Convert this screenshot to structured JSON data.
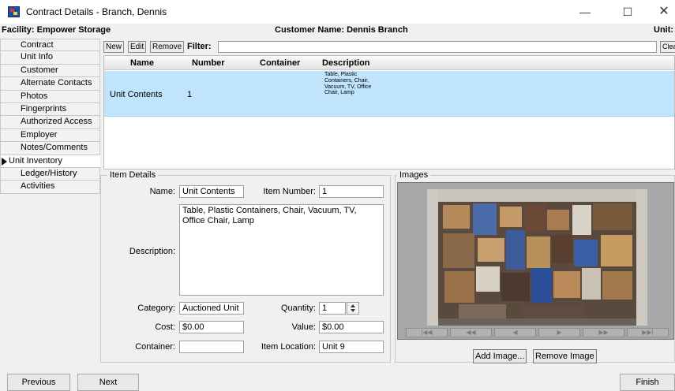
{
  "window": {
    "title": "Contract Details - Branch, Dennis",
    "minimize": "—",
    "maximize": "☐",
    "close": "✕"
  },
  "info": {
    "facility": "Facility: Empower Storage",
    "customer": "Customer Name: Dennis Branch",
    "unit": "Unit:"
  },
  "nav": {
    "items": [
      "Contract",
      "Unit Info",
      "Customer",
      "Alternate Contacts",
      "Photos",
      "Fingerprints",
      "Authorized Access",
      "Employer",
      "Notes/Comments",
      "Unit Inventory",
      "Ledger/History",
      "Activities"
    ],
    "active_index": 9
  },
  "toolbar": {
    "new": "New",
    "edit": "Edit",
    "remove": "Remove",
    "filter_label": "Filter:",
    "filter_value": "",
    "clear": "Clear"
  },
  "grid": {
    "columns": [
      "Name",
      "Number",
      "Container",
      "Description"
    ],
    "rows": [
      {
        "name": "Unit Contents",
        "number": "1",
        "container": "",
        "description": "Table, Plastic Containers, Chair, Vacuum, TV, Office Chair, Lamp"
      }
    ]
  },
  "details": {
    "title": "Item Details",
    "name_label": "Name:",
    "name_value": "Unit Contents",
    "number_label": "Item Number:",
    "number_value": "1",
    "description_label": "Description:",
    "description_value": "Table, Plastic Containers, Chair, Vacuum, TV, Office Chair, Lamp",
    "category_label": "Category:",
    "category_value": "Auctioned Unit",
    "quantity_label": "Quantity:",
    "quantity_value": "1",
    "cost_label": "Cost:",
    "cost_value": "$0.00",
    "value_label": "Value:",
    "value_value": "$0.00",
    "container_label": "Container:",
    "container_value": "",
    "location_label": "Item Location:",
    "location_value": "Unit 9"
  },
  "images": {
    "title": "Images",
    "nav": [
      "|◀◀",
      "◀◀",
      "◀",
      "▶",
      "▶▶",
      "▶▶|"
    ],
    "add": "Add Image...",
    "remove": "Remove Image"
  },
  "footer": {
    "previous": "Previous",
    "next": "Next",
    "finish": "Finish"
  }
}
